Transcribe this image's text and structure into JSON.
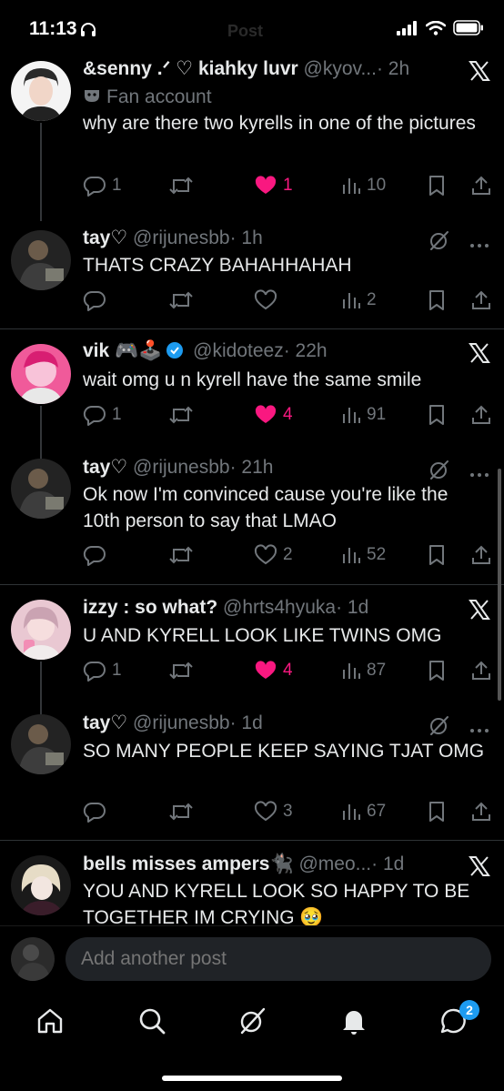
{
  "status_bar": {
    "time": "11:13",
    "ghost_title": "Post"
  },
  "colors": {
    "background": "#000000",
    "text": "#e7e9ea",
    "muted": "#71767b",
    "like": "#f91880",
    "accent": "#1d9bf0"
  },
  "posts": [
    {
      "name": "&senny .ᐟ ♡ kiahky luvr",
      "handle": "@kyov...",
      "time": "· 2h",
      "label": "Fan account",
      "text": "why are there two kyrells in one of the pictures",
      "replies": "1",
      "reposts": "",
      "likes": "1",
      "views": "10",
      "liked": true,
      "top_icon": "x-logo-icon"
    },
    {
      "name": "tay♡",
      "handle": "@rijunesbb",
      "time": "· 1h",
      "text": "THATS CRAZY BAHAHHAHAH",
      "replies": "",
      "reposts": "",
      "likes": "",
      "views": "2",
      "liked": false,
      "top_icon": "grok-icon"
    },
    {
      "name": "vik 🎮🕹️",
      "handle": "@kidoteez",
      "time": "· 22h",
      "text": "wait omg u n kyrell have the same smile",
      "replies": "1",
      "reposts": "",
      "likes": "4",
      "views": "91",
      "liked": true,
      "top_icon": "x-logo-icon"
    },
    {
      "name": "tay♡",
      "handle": "@rijunesbb",
      "time": "· 21h",
      "text": "Ok now I'm convinced cause you're like the 10th person to say that LMAO",
      "replies": "",
      "reposts": "",
      "likes": "2",
      "views": "52",
      "liked": false,
      "top_icon": "grok-icon"
    },
    {
      "name": "izzy : so what?",
      "handle": "@hrts4hyuka",
      "time": "· 1d",
      "text": "U AND KYRELL LOOK LIKE TWINS OMG",
      "replies": "1",
      "reposts": "",
      "likes": "4",
      "views": "87",
      "liked": true,
      "top_icon": "x-logo-icon"
    },
    {
      "name": "tay♡",
      "handle": "@rijunesbb",
      "time": "· 1d",
      "text": "SO MANY PEOPLE KEEP SAYING TJAT OMG",
      "replies": "",
      "reposts": "",
      "likes": "3",
      "views": "67",
      "liked": false,
      "top_icon": "grok-icon"
    },
    {
      "name": "bells misses ampers🐈‍⬛",
      "handle": "@meo...",
      "time": "· 1d",
      "text": "YOU AND KYRELL LOOK SO HAPPY TO BE TOGETHER IM CRYING 🥹",
      "top_icon": "x-logo-icon"
    }
  ],
  "reply_bar": {
    "placeholder": "Add another post"
  },
  "tab_bar": {
    "messages_badge": "2"
  }
}
